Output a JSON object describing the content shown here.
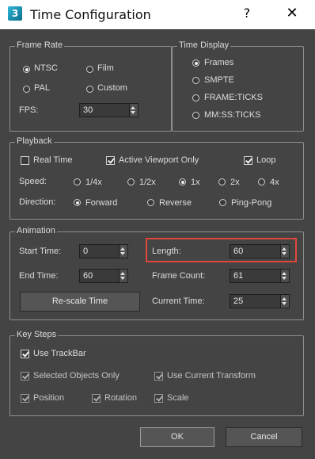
{
  "window": {
    "title": "Time Configuration",
    "icon_text": "3",
    "help_label": "?",
    "close_label": "✕"
  },
  "frame_rate": {
    "legend": "Frame Rate",
    "options": [
      "NTSC",
      "Film",
      "PAL",
      "Custom"
    ],
    "selected": "NTSC",
    "fps_label": "FPS:",
    "fps_value": "30"
  },
  "time_display": {
    "legend": "Time Display",
    "options": [
      "Frames",
      "SMPTE",
      "FRAME:TICKS",
      "MM:SS:TICKS"
    ],
    "selected": "Frames"
  },
  "playback": {
    "legend": "Playback",
    "real_time_label": "Real Time",
    "real_time_checked": false,
    "active_viewport_label": "Active Viewport Only",
    "active_viewport_checked": true,
    "loop_label": "Loop",
    "loop_checked": true,
    "speed_label": "Speed:",
    "speed_options": [
      "1/4x",
      "1/2x",
      "1x",
      "2x",
      "4x"
    ],
    "speed_selected": "1x",
    "direction_label": "Direction:",
    "direction_options": [
      "Forward",
      "Reverse",
      "Ping-Pong"
    ],
    "direction_selected": "Forward"
  },
  "animation": {
    "legend": "Animation",
    "start_time_label": "Start Time:",
    "start_time_value": "0",
    "end_time_label": "End Time:",
    "end_time_value": "60",
    "length_label": "Length:",
    "length_value": "60",
    "frame_count_label": "Frame Count:",
    "frame_count_value": "61",
    "current_time_label": "Current Time:",
    "current_time_value": "25",
    "rescale_label": "Re-scale Time",
    "highlight_color": "#e0473a"
  },
  "key_steps": {
    "legend": "Key Steps",
    "use_trackbar_label": "Use TrackBar",
    "use_trackbar_checked": true,
    "selected_only_label": "Selected Objects Only",
    "use_current_transform_label": "Use Current Transform",
    "position_label": "Position",
    "rotation_label": "Rotation",
    "scale_label": "Scale"
  },
  "footer": {
    "ok_label": "OK",
    "cancel_label": "Cancel"
  },
  "colors": {
    "background": "#444444",
    "text": "#dcdcdc",
    "accent_highlight": "#e0473a"
  }
}
